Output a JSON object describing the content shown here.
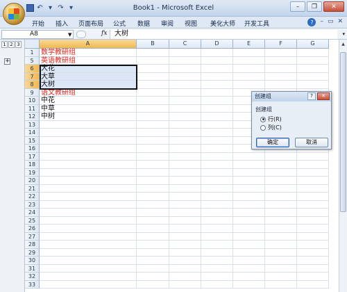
{
  "window": {
    "title": "Book1 - Microsoft Excel",
    "controls": [
      "–",
      "❐",
      "✕"
    ]
  },
  "ribbon": {
    "tabs": [
      "开始",
      "插入",
      "页面布局",
      "公式",
      "数据",
      "审阅",
      "视图",
      "美化大师",
      "开发工具"
    ],
    "right_icons": [
      "?",
      "–",
      "▭",
      "✕"
    ]
  },
  "formula_bar": {
    "name_box": "A8",
    "fx": "fx",
    "value": "大树"
  },
  "outline": {
    "levels": [
      "1",
      "2",
      "3"
    ],
    "toggle": "+"
  },
  "columns": [
    "A",
    "B",
    "C",
    "D",
    "E",
    "F",
    "G"
  ],
  "selected_column": "A",
  "rows": [
    {
      "num": "1",
      "a": "数学教研组",
      "style": "red"
    },
    {
      "num": "5",
      "a": "英语教研组",
      "style": "red"
    },
    {
      "num": "6",
      "a": "大花",
      "style": "selected"
    },
    {
      "num": "7",
      "a": "大草",
      "style": "selected"
    },
    {
      "num": "8",
      "a": "大树",
      "style": "selected"
    },
    {
      "num": "9",
      "a": "语文教研组",
      "style": "red"
    },
    {
      "num": "10",
      "a": "中花",
      "style": ""
    },
    {
      "num": "11",
      "a": "中草",
      "style": ""
    },
    {
      "num": "12",
      "a": "中树",
      "style": ""
    },
    {
      "num": "13",
      "a": "",
      "style": ""
    },
    {
      "num": "14",
      "a": "",
      "style": ""
    },
    {
      "num": "15",
      "a": "",
      "style": ""
    },
    {
      "num": "16",
      "a": "",
      "style": ""
    },
    {
      "num": "17",
      "a": "",
      "style": ""
    },
    {
      "num": "18",
      "a": "",
      "style": ""
    },
    {
      "num": "19",
      "a": "",
      "style": ""
    },
    {
      "num": "20",
      "a": "",
      "style": ""
    },
    {
      "num": "21",
      "a": "",
      "style": ""
    },
    {
      "num": "22",
      "a": "",
      "style": ""
    },
    {
      "num": "23",
      "a": "",
      "style": ""
    },
    {
      "num": "24",
      "a": "",
      "style": ""
    },
    {
      "num": "25",
      "a": "",
      "style": ""
    },
    {
      "num": "26",
      "a": "",
      "style": ""
    },
    {
      "num": "27",
      "a": "",
      "style": ""
    },
    {
      "num": "28",
      "a": "",
      "style": ""
    },
    {
      "num": "29",
      "a": "",
      "style": ""
    },
    {
      "num": "30",
      "a": "",
      "style": ""
    },
    {
      "num": "31",
      "a": "",
      "style": ""
    },
    {
      "num": "32",
      "a": "",
      "style": ""
    },
    {
      "num": "33",
      "a": "",
      "style": ""
    }
  ],
  "dialog": {
    "title": "创建组",
    "help": "?",
    "close": "✕",
    "group_label": "创建组",
    "options": [
      {
        "label": "行(R)",
        "checked": true
      },
      {
        "label": "列(C)",
        "checked": false
      }
    ],
    "ok": "确定",
    "cancel": "取消"
  },
  "colors": {
    "red_text": "#e2231a",
    "selection_fill": "#dbe6f6",
    "header_selected": "#f1b84c"
  }
}
